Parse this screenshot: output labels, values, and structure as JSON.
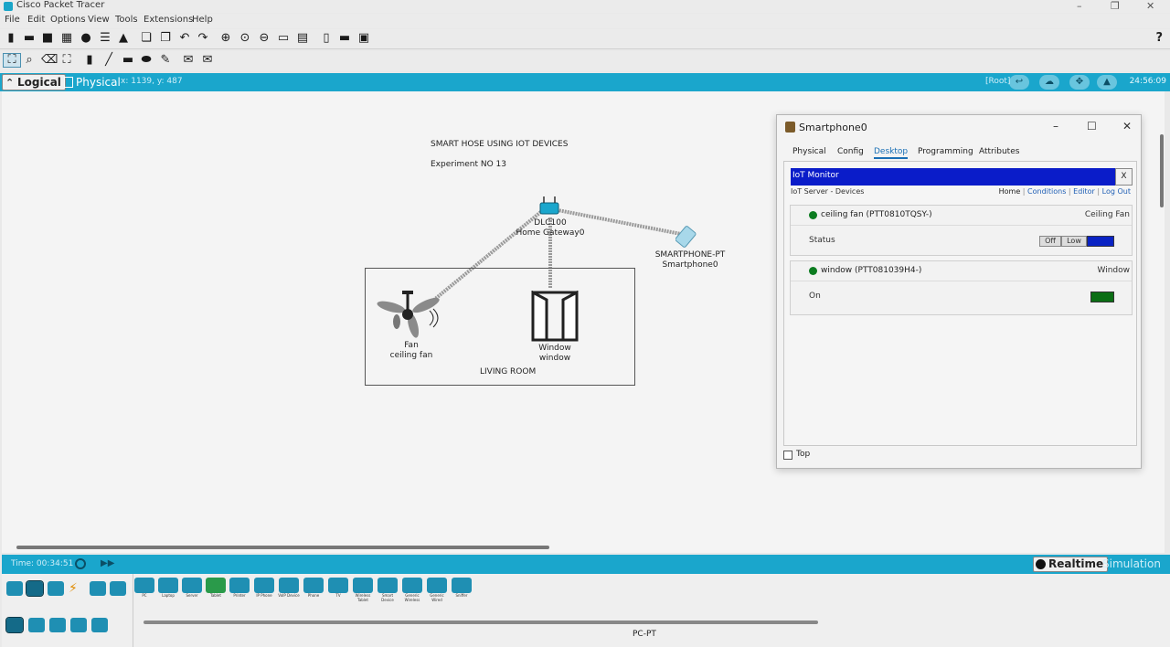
{
  "app": {
    "title": "Cisco Packet Tracer"
  },
  "menu": [
    "File",
    "Edit",
    "Options",
    "View",
    "Tools",
    "Extensions",
    "Help"
  ],
  "toolbar": {
    "help": "?"
  },
  "modebar": {
    "logical": "Logical",
    "physical": "Physical",
    "coords": "x: 1139, y: 487",
    "root": "[Root]",
    "clock": "24:56:09"
  },
  "canvas": {
    "title": "SMART HOSE USING IOT DEVICES",
    "experiment": "Experiment NO 13",
    "room_label": "LIVING ROOM",
    "devices": [
      {
        "model": "DLC100",
        "name": "Home Gateway0"
      },
      {
        "model": "SMARTPHONE-PT",
        "name": "Smartphone0"
      },
      {
        "model": "Fan",
        "name": "ceiling fan"
      },
      {
        "model": "Window",
        "name": "window"
      }
    ]
  },
  "dialog": {
    "title": "Smartphone0",
    "tabs": [
      "Physical",
      "Config",
      "Desktop",
      "Programming",
      "Attributes"
    ],
    "active_tab": "Desktop",
    "iot": {
      "header": "IoT Monitor",
      "close": "X",
      "subtitle": "IoT Server - Devices",
      "links": [
        "Home",
        "Conditions",
        "Editor",
        "Log Out"
      ],
      "devices": [
        {
          "name": "ceiling fan (PTT0810TQSY-)",
          "type": "Ceiling Fan",
          "row_label": "Status",
          "options": [
            "Off",
            "Low"
          ],
          "status_color": "#0a23c4"
        },
        {
          "name": "window (PTT081039H4-)",
          "type": "Window",
          "row_label": "On",
          "status_color": "#0b6e14"
        }
      ]
    },
    "top_label": "Top"
  },
  "bottom": {
    "time": "Time: 00:34:51",
    "realtime": "Realtime",
    "simulation": "Simulation",
    "palette": [
      "PC",
      "Laptop",
      "Server",
      "Tablet",
      "Printer",
      "IP Phone",
      "VoIP Device",
      "Phone",
      "TV",
      "Wireless Tablet",
      "Smart Device",
      "Generic Wireless",
      "Generic Wired",
      "Sniffer"
    ],
    "selected_device": "PC-PT"
  }
}
